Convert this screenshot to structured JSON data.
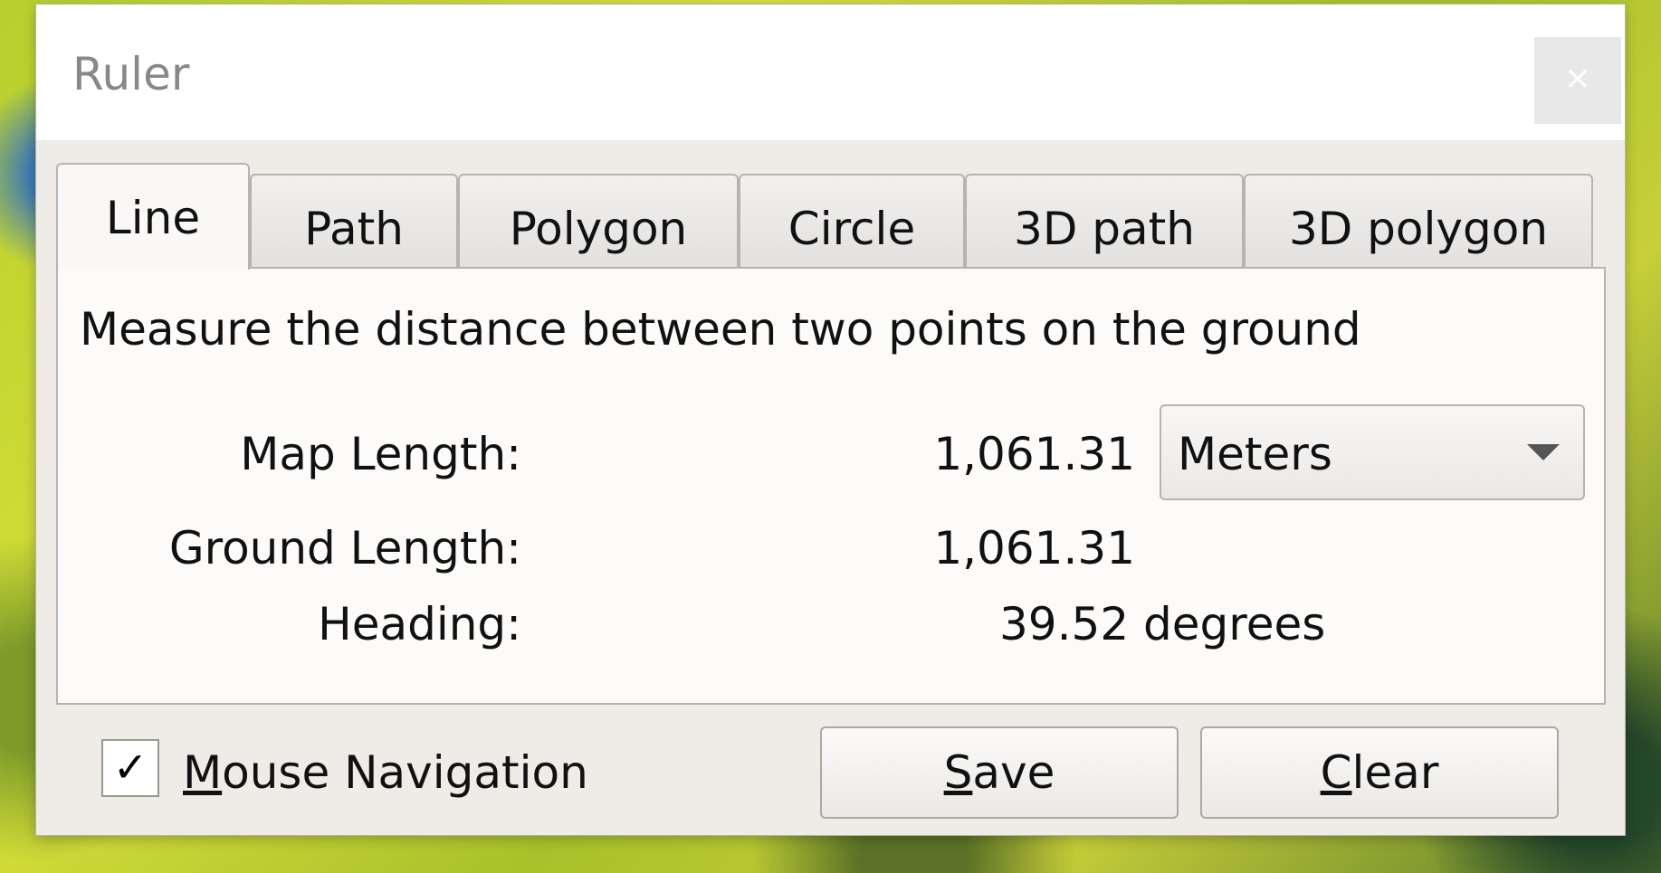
{
  "window": {
    "title": "Ruler",
    "close_label": "×"
  },
  "tabs": [
    {
      "label": "Line",
      "active": true
    },
    {
      "label": "Path",
      "active": false
    },
    {
      "label": "Polygon",
      "active": false
    },
    {
      "label": "Circle",
      "active": false
    },
    {
      "label": "3D path",
      "active": false
    },
    {
      "label": "3D polygon",
      "active": false
    }
  ],
  "panel": {
    "description": "Measure the distance between two points on the ground",
    "map_length_label": "Map Length:",
    "map_length_value": "1,061.31",
    "ground_length_label": "Ground Length:",
    "ground_length_value": "1,061.31",
    "heading_label": "Heading:",
    "heading_value": "39.52 degrees",
    "unit_selected": "Meters"
  },
  "footer": {
    "mouse_navigation_checked": true,
    "check_glyph": "✓",
    "mouse_navigation_label": "Mouse Navigation",
    "save_label": "Save",
    "clear_label": "Clear"
  }
}
